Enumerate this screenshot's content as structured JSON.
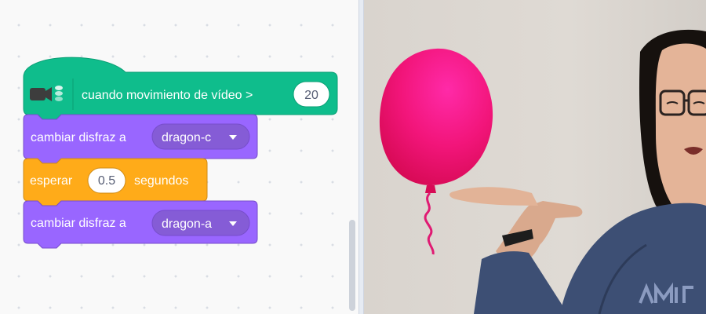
{
  "script": {
    "hat": {
      "label": "cuando movimiento de vídeo >",
      "value": "20",
      "icon": "video-sensing-icon"
    },
    "costume_block_1": {
      "label": "cambiar disfraz a",
      "costume": "dragon-c"
    },
    "wait_block": {
      "label_before": "esperar",
      "value": "0.5",
      "label_after": "segundos"
    },
    "costume_block_2": {
      "label": "cambiar disfraz a",
      "costume": "dragon-a"
    }
  },
  "colors": {
    "video_sensing": "#0fbd8c",
    "looks": "#9966ff",
    "control": "#ffab19",
    "balloon": "#f2157a"
  },
  "stage": {
    "sprite": "balloon",
    "background": "webcam-video-feed"
  }
}
